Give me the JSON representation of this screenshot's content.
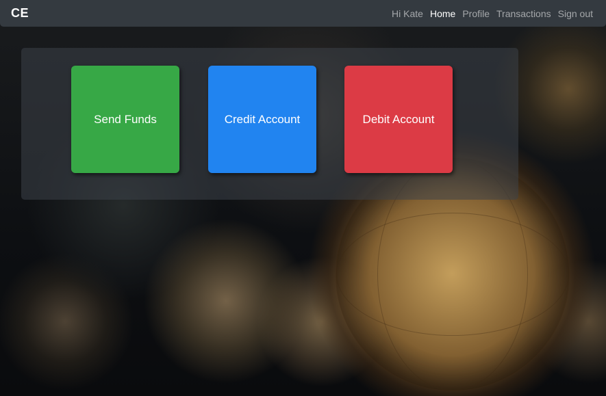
{
  "navbar": {
    "brand": "CE",
    "greeting": "Hi Kate",
    "links": [
      {
        "label": "Home",
        "active": true
      },
      {
        "label": "Profile",
        "active": false
      },
      {
        "label": "Transactions",
        "active": false
      },
      {
        "label": "Sign out",
        "active": false
      }
    ]
  },
  "actions": {
    "send_label": "Send Funds",
    "credit_label": "Credit Account",
    "debit_label": "Debit Account"
  },
  "colors": {
    "navbar": "#343a40",
    "send": "#37a846",
    "credit": "#2184f0",
    "debit": "#dc3b45"
  }
}
